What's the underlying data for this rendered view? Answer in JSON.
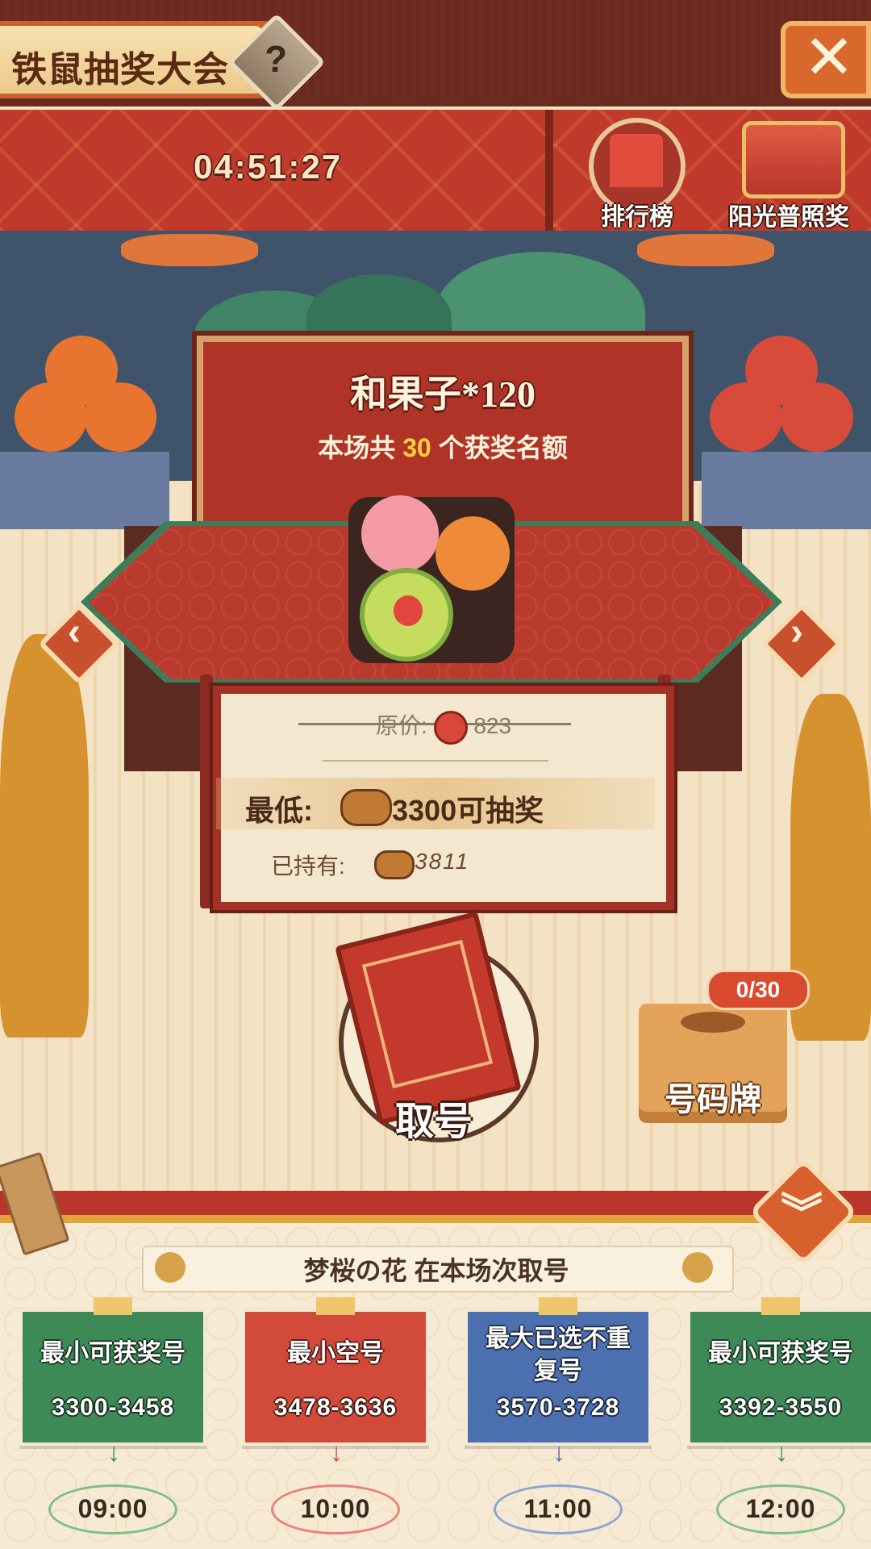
{
  "header": {
    "title": "铁鼠抽奖大会",
    "help_glyph": "?",
    "close_glyph": "✕"
  },
  "timer": "04:51:27",
  "side_buttons": {
    "ranking_label": "排行榜",
    "sunshine_label": "阳光普照奖"
  },
  "prize": {
    "name": "和果子*120",
    "quota_prefix": "本场共",
    "quota_count": "30",
    "quota_suffix": "个获奖名额"
  },
  "price": {
    "original_label": "原价:",
    "original_value": "823",
    "min_label": "最低:",
    "min_value": "3300可抽奖",
    "owned_label": "已持有:",
    "owned_value": "3811"
  },
  "take_number_label": "取号",
  "number_box": {
    "label": "号码牌",
    "count": "0/30"
  },
  "nav": {
    "prev_glyph": "‹",
    "next_glyph": "›",
    "expand_glyph": "︾"
  },
  "session_subtitle": "梦桜の花 在本场次取号",
  "cards": [
    {
      "title": "最小可获奖号",
      "range": "3300-3458",
      "time": "09:00",
      "color": "#3d8a57",
      "oval": "#7fbf86"
    },
    {
      "title": "最小空号",
      "range": "3478-3636",
      "time": "10:00",
      "color": "#d24a3a",
      "oval": "#e8827a"
    },
    {
      "title": "最大已选不重复号",
      "range": "3570-3728",
      "time": "11:00",
      "color": "#4c6fb0",
      "oval": "#8aa5d6"
    },
    {
      "title": "最小可获奖号",
      "range": "3392-3550",
      "time": "12:00",
      "color": "#3d8a57",
      "oval": "#7fbf86"
    }
  ],
  "icons": {
    "help": "question-icon",
    "close": "close-icon",
    "ranking": "ranking-tower-icon",
    "sunshine": "treasure-chest-icon",
    "currency": "log-icon",
    "coin": "coin-icon"
  }
}
